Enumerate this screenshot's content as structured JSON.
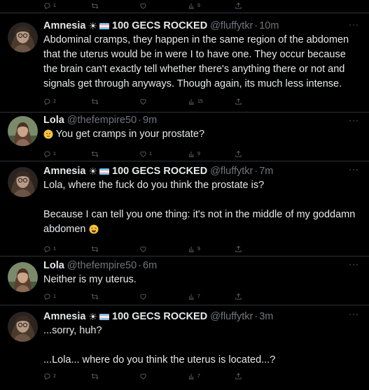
{
  "top_actions": {
    "reply": "1",
    "retweet": "",
    "like": "",
    "views": "9"
  },
  "tweets": [
    {
      "name": "Amnesia",
      "badge_text": "100 GECS ROCKED",
      "handle": "@fluffytkr",
      "time": "10m",
      "lines": [
        "Abdominal cramps, they happen in the same region of the abdomen",
        "that the uterus would be in were I to have one. They occur because",
        "the brain can't exactly tell whether there's anything there or not and",
        "signals get through anyways. Though again, its much less intense."
      ],
      "actions": {
        "reply": "2",
        "retweet": "",
        "like": "",
        "views": "15"
      }
    },
    {
      "name": "Lola",
      "handle": "@thefempire50",
      "time": "9m",
      "lines": [
        "You get cramps in your prostate?"
      ],
      "actions": {
        "reply": "1",
        "retweet": "",
        "like": "1",
        "views": "9"
      }
    },
    {
      "name": "Amnesia",
      "badge_text": "100 GECS ROCKED",
      "handle": "@fluffytkr",
      "time": "7m",
      "lines": [
        "Lola, where the fuck do you think the prostate is?",
        "",
        "Because I can tell you one thing: it's not in the middle of my goddamn",
        "abdomen"
      ],
      "actions": {
        "reply": "1",
        "retweet": "",
        "like": "",
        "views": "9"
      }
    },
    {
      "name": "Lola",
      "handle": "@thefempire50",
      "time": "6m",
      "lines": [
        "Neither is my uterus."
      ],
      "actions": {
        "reply": "1",
        "retweet": "",
        "like": "",
        "views": "7"
      }
    },
    {
      "name": "Amnesia",
      "badge_text": "100 GECS ROCKED",
      "handle": "@fluffytkr",
      "time": "3m",
      "lines": [
        "...sorry, huh?",
        "",
        "...Lola... where do you think the uterus is located...?"
      ],
      "actions": {
        "reply": "2",
        "retweet": "",
        "like": "",
        "views": "7"
      }
    }
  ],
  "ui": {
    "more": "···",
    "separator": "·"
  },
  "colors": {
    "bg": "#000000",
    "text": "#e7e9ea",
    "muted": "#71767b",
    "divider": "#2f3336"
  },
  "icons": [
    "reply-icon",
    "retweet-icon",
    "like-icon",
    "views-icon",
    "share-icon",
    "sun-emoji",
    "trans-flag-emoji",
    "thinking-emoji",
    "laughing-emoji"
  ]
}
